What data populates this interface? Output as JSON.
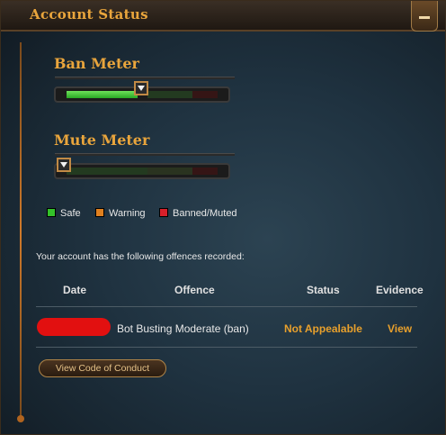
{
  "window": {
    "title": "Account Status"
  },
  "ban_meter": {
    "label": "Ban Meter",
    "level": 0.47
  },
  "mute_meter": {
    "label": "Mute Meter",
    "level": 0.0
  },
  "legend": [
    {
      "label": "Safe",
      "color": "#34c22a"
    },
    {
      "label": "Warning",
      "color": "#e0801f"
    },
    {
      "label": "Banned/Muted",
      "color": "#d8202a"
    }
  ],
  "offences": {
    "intro": "Your account has the following offences recorded:",
    "columns": [
      "Date",
      "Offence",
      "Status",
      "Evidence"
    ],
    "rows": [
      {
        "offence": "Bot Busting Moderate (ban)",
        "status": "Not Appealable",
        "evidence": "View"
      }
    ]
  },
  "buttons": {
    "code_of_conduct": "View Code of Conduct"
  },
  "colors": {
    "accent_gold": "#e9a53c",
    "status_text": "#e8a02c"
  }
}
